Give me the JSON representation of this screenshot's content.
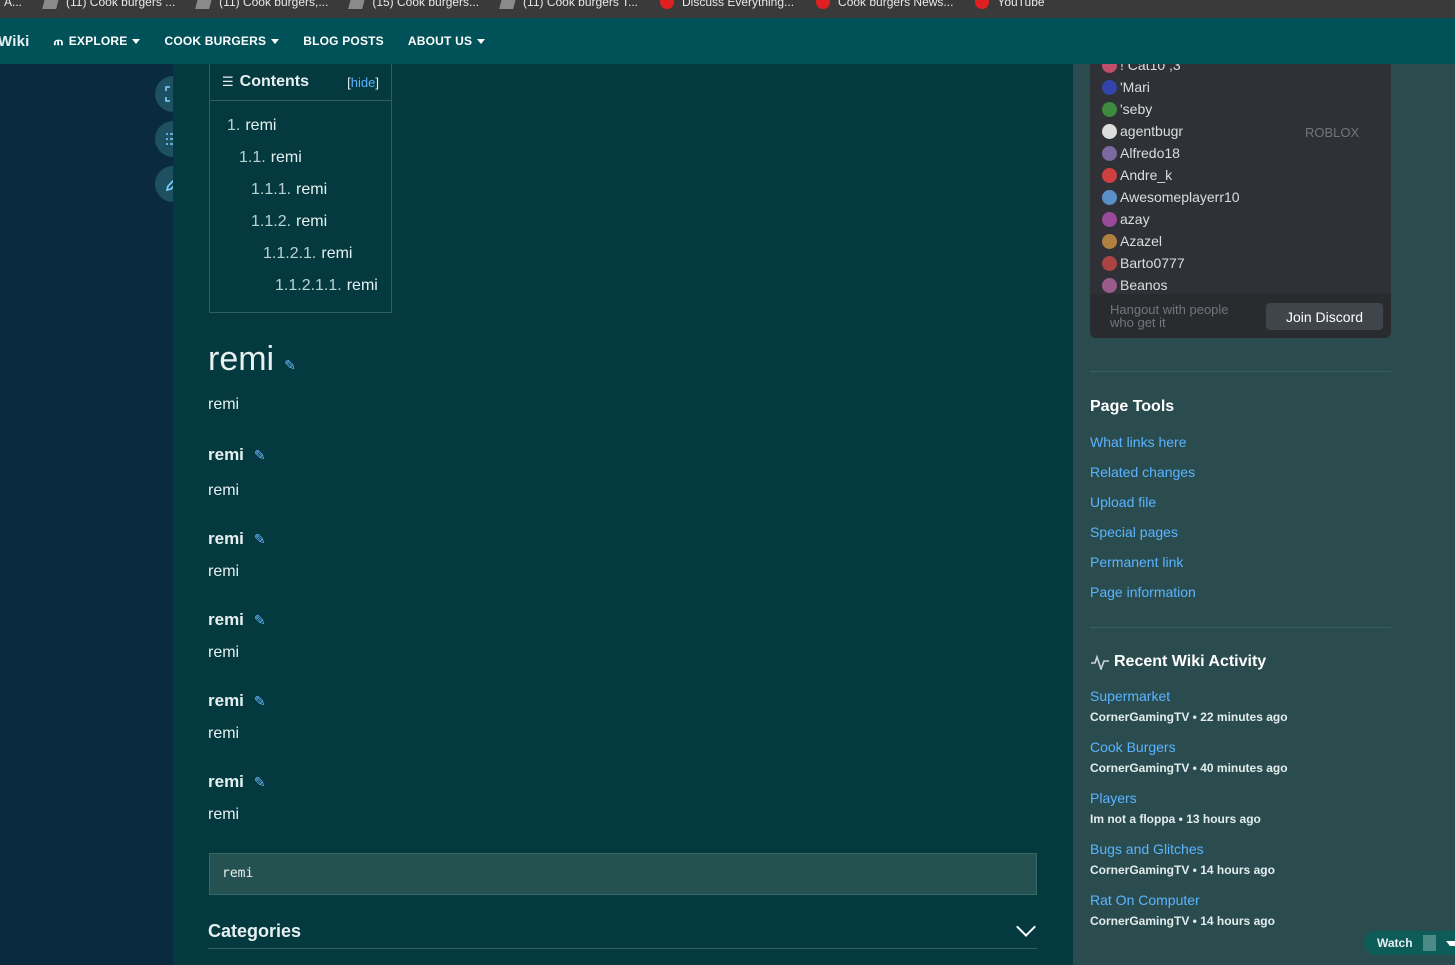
{
  "bookmarks": [
    {
      "label": "A..."
    },
    {
      "label": "(11) Cook burgers ..."
    },
    {
      "label": "(11) Cook burgers,..."
    },
    {
      "label": "(15) Cook burgers..."
    },
    {
      "label": "(11) Cook burgers T..."
    },
    {
      "label": "Discuss Everything..."
    },
    {
      "label": "Cook burgers News..."
    },
    {
      "label": "YouTube"
    }
  ],
  "nav": {
    "brand": "Wiki",
    "explore": "EXPLORE",
    "cook_burgers": "COOK BURGERS",
    "blog_posts": "BLOG POSTS",
    "about_us": "ABOUT US"
  },
  "toc": {
    "title": "Contents",
    "hide": "hide",
    "items": [
      {
        "num": "1.",
        "label": "remi"
      },
      {
        "num": "1.1.",
        "label": "remi"
      },
      {
        "num": "1.1.1.",
        "label": "remi"
      },
      {
        "num": "1.1.2.",
        "label": "remi"
      },
      {
        "num": "1.1.2.1.",
        "label": "remi"
      },
      {
        "num": "1.1.2.1.1.",
        "label": "remi"
      }
    ]
  },
  "content": {
    "h1": "remi",
    "p0": "remi",
    "sections": [
      {
        "heading": "remi",
        "text": "remi"
      },
      {
        "heading": "remi",
        "text": "remi"
      },
      {
        "heading": "remi",
        "text": "remi"
      },
      {
        "heading": "remi",
        "text": "remi"
      },
      {
        "heading": "remi",
        "text": "remi"
      }
    ],
    "pre": "remi",
    "categories": "Categories"
  },
  "discord": {
    "members": [
      "! Cat10 ;3",
      "'Mari",
      "'seby",
      "agentbugr",
      "Alfredo18",
      "Andre_k",
      "Awesomeplayerr10",
      "azay",
      "Azazel",
      "Barto0777",
      "Beanos"
    ],
    "game": "ROBLOX",
    "footer_text": "Hangout with people who get it",
    "join": "Join Discord",
    "avatar_colors": [
      "#c0506a",
      "#3344aa",
      "#3e8a3e",
      "#dddddd",
      "#7a6aa0",
      "#d04040",
      "#5b8fc7",
      "#9a4a9a",
      "#b08040",
      "#aa4444",
      "#9a5a8a"
    ]
  },
  "page_tools": {
    "title": "Page Tools",
    "links": [
      "What links here",
      "Related changes",
      "Upload file",
      "Special pages",
      "Permanent link",
      "Page information"
    ]
  },
  "activity": {
    "title": "Recent Wiki Activity",
    "items": [
      {
        "title": "Supermarket",
        "meta": "CornerGamingTV • 22 minutes ago"
      },
      {
        "title": "Cook Burgers",
        "meta": "CornerGamingTV • 40 minutes ago"
      },
      {
        "title": "Players",
        "meta": "Im not a floppa • 13 hours ago"
      },
      {
        "title": "Bugs and Glitches",
        "meta": "CornerGamingTV • 14 hours ago"
      },
      {
        "title": "Rat On Computer",
        "meta": "CornerGamingTV • 14 hours ago"
      }
    ]
  },
  "watch": {
    "label": "Watch"
  }
}
